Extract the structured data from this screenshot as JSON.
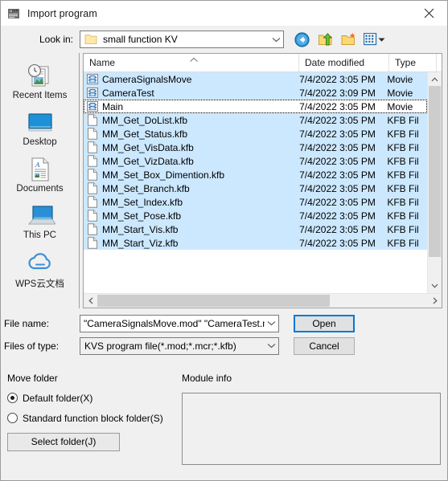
{
  "window": {
    "title": "Import program",
    "icon": "program-module-icon",
    "close_label": "Close"
  },
  "lookin": {
    "label": "Look in:",
    "value": "small function KV",
    "folder_icon": "folder-icon",
    "dropdown_icon": "chevron-down-icon"
  },
  "toolbar": {
    "buttons": [
      {
        "name": "back-button",
        "icon": "back-arrow-icon",
        "tooltip": "Back"
      },
      {
        "name": "up-one-level-button",
        "icon": "up-folder-icon",
        "tooltip": "Up one level"
      },
      {
        "name": "new-folder-button",
        "icon": "new-folder-icon",
        "tooltip": "Create New Folder"
      },
      {
        "name": "views-button",
        "icon": "views-icon",
        "tooltip": "Views"
      }
    ]
  },
  "places": [
    {
      "label": "Recent Items",
      "icon": "recent-items-icon"
    },
    {
      "label": "Desktop",
      "icon": "desktop-icon"
    },
    {
      "label": "Documents",
      "icon": "documents-icon"
    },
    {
      "label": "This PC",
      "icon": "this-pc-icon"
    },
    {
      "label": "WPS云文档",
      "icon": "wps-cloud-icon"
    }
  ],
  "filelist": {
    "columns": [
      "Name",
      "Date modified",
      "Type"
    ],
    "sort_column": "Name",
    "sort_direction": "ascending",
    "rows": [
      {
        "name": "CameraSignalsMove",
        "date": "7/4/2022 3:05 PM",
        "type": "Movie",
        "icon": "movie-file-icon",
        "selected": true,
        "focused": false
      },
      {
        "name": "CameraTest",
        "date": "7/4/2022 3:09 PM",
        "type": "Movie",
        "icon": "movie-file-icon",
        "selected": true,
        "focused": false
      },
      {
        "name": "Main",
        "date": "7/4/2022 3:05 PM",
        "type": "Movie",
        "icon": "movie-file-icon",
        "selected": false,
        "focused": true
      },
      {
        "name": "MM_Get_DoList.kfb",
        "date": "7/4/2022 3:05 PM",
        "type": "KFB Fil",
        "icon": "generic-file-icon",
        "selected": true,
        "focused": false
      },
      {
        "name": "MM_Get_Status.kfb",
        "date": "7/4/2022 3:05 PM",
        "type": "KFB Fil",
        "icon": "generic-file-icon",
        "selected": true,
        "focused": false
      },
      {
        "name": "MM_Get_VisData.kfb",
        "date": "7/4/2022 3:05 PM",
        "type": "KFB Fil",
        "icon": "generic-file-icon",
        "selected": true,
        "focused": false
      },
      {
        "name": "MM_Get_VizData.kfb",
        "date": "7/4/2022 3:05 PM",
        "type": "KFB Fil",
        "icon": "generic-file-icon",
        "selected": true,
        "focused": false
      },
      {
        "name": "MM_Set_Box_Dimention.kfb",
        "date": "7/4/2022 3:05 PM",
        "type": "KFB Fil",
        "icon": "generic-file-icon",
        "selected": true,
        "focused": false
      },
      {
        "name": "MM_Set_Branch.kfb",
        "date": "7/4/2022 3:05 PM",
        "type": "KFB Fil",
        "icon": "generic-file-icon",
        "selected": true,
        "focused": false
      },
      {
        "name": "MM_Set_Index.kfb",
        "date": "7/4/2022 3:05 PM",
        "type": "KFB Fil",
        "icon": "generic-file-icon",
        "selected": true,
        "focused": false
      },
      {
        "name": "MM_Set_Pose.kfb",
        "date": "7/4/2022 3:05 PM",
        "type": "KFB Fil",
        "icon": "generic-file-icon",
        "selected": true,
        "focused": false
      },
      {
        "name": "MM_Start_Vis.kfb",
        "date": "7/4/2022 3:05 PM",
        "type": "KFB Fil",
        "icon": "generic-file-icon",
        "selected": true,
        "focused": false
      },
      {
        "name": "MM_Start_Viz.kfb",
        "date": "7/4/2022 3:05 PM",
        "type": "KFB Fil",
        "icon": "generic-file-icon",
        "selected": true,
        "focused": false
      }
    ],
    "scrollbars": {
      "vertical": {
        "up_icon": "chevron-up-icon",
        "down_icon": "chevron-down-icon"
      },
      "horizontal": {
        "left_icon": "chevron-left-icon",
        "right_icon": "chevron-right-icon"
      }
    }
  },
  "filename": {
    "label": "File name:",
    "value": "\"CameraSignalsMove.mod\" \"CameraTest.mod\"",
    "dropdown_icon": "chevron-down-icon"
  },
  "filetype": {
    "label": "Files of type:",
    "value": "KVS program file(*.mod;*.mcr;*.kfb)",
    "dropdown_icon": "chevron-down-icon"
  },
  "buttons": {
    "open": "Open",
    "cancel": "Cancel"
  },
  "movefolder": {
    "title": "Move folder",
    "options": [
      {
        "label": "Default folder(X)",
        "checked": true
      },
      {
        "label": "Standard function block folder(S)",
        "checked": false
      }
    ],
    "select_folder_button": "Select folder(J)"
  },
  "moduleinfo": {
    "title": "Module info",
    "content": ""
  },
  "colors": {
    "selection": "#cce8ff",
    "accent": "#0078d7",
    "dialog_bg": "#f0f0f0",
    "border": "#a0a0a0"
  }
}
